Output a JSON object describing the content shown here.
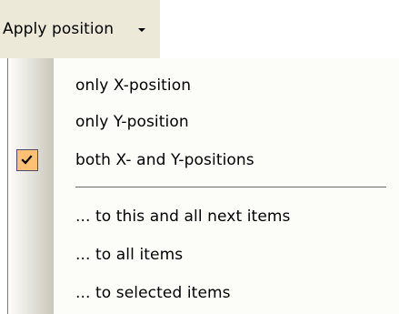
{
  "menu": {
    "title": "Apply position",
    "arrow_icon": "dropdown-arrow-icon"
  },
  "items": [
    {
      "label": "only X-position",
      "checked": false
    },
    {
      "label": "only Y-position",
      "checked": false
    },
    {
      "label": "both X- and Y-positions",
      "checked": true
    },
    {
      "label": "... to this and all next items",
      "checked": false
    },
    {
      "label": "... to all items",
      "checked": false
    },
    {
      "label": "... to selected items",
      "checked": false
    }
  ],
  "check_icon": "checkmark-icon",
  "colors": {
    "menu_bar": "#ece9d8",
    "checked_background": "#ffc073",
    "checked_border": "#4b4b6f"
  }
}
